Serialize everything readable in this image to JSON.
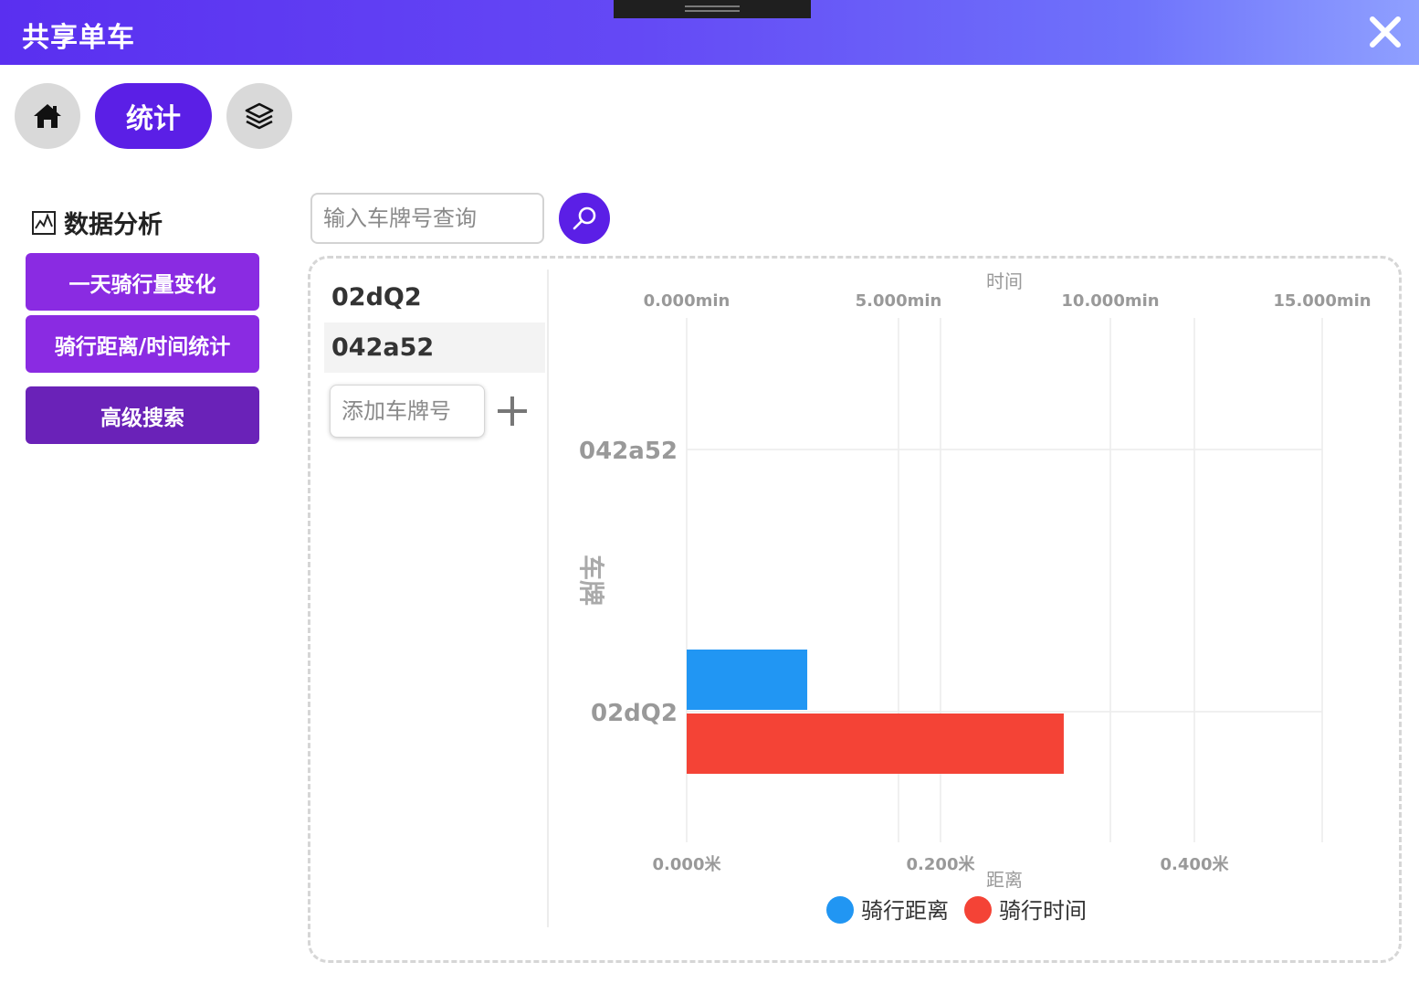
{
  "app": {
    "title": "共享单车"
  },
  "nav": {
    "home_icon": "home-icon",
    "stats_label": "统计",
    "layers_icon": "layers-icon"
  },
  "sidebar": {
    "title": "数据分析",
    "icon": "line-chart-icon",
    "items": [
      {
        "label": "一天骑行量变化"
      },
      {
        "label": "骑行距离/时间统计"
      },
      {
        "label": "高级搜索"
      }
    ]
  },
  "search": {
    "placeholder": "输入车牌号查询",
    "value": ""
  },
  "plates": {
    "items": [
      {
        "label": "02dQ2"
      },
      {
        "label": "042a52"
      }
    ],
    "add_placeholder": "添加车牌号"
  },
  "colors": {
    "accent": "#5b1fe6",
    "button": "#8a2be2",
    "distance": "#2196f3",
    "time": "#f44336"
  },
  "chart_data": {
    "type": "bar",
    "orientation": "horizontal",
    "categories": [
      "042a52",
      "02dQ2"
    ],
    "ylabel": "车牌",
    "series": [
      {
        "name": "骑行距离",
        "axis": "距离",
        "values": [
          0,
          0.095
        ],
        "color": "#2196f3"
      },
      {
        "name": "骑行时间",
        "axis": "时间",
        "values": [
          0,
          8.9
        ],
        "color": "#f44336"
      }
    ],
    "distance_axis": {
      "label": "距离",
      "ticks": [
        "0.000米",
        "0.200米",
        "0.400米"
      ],
      "range": [
        0,
        0.5
      ]
    },
    "time_axis": {
      "label": "时间",
      "ticks": [
        "0.000min",
        "5.000min",
        "10.000min",
        "15.000min"
      ],
      "range": [
        0,
        15
      ]
    },
    "grid": true,
    "legend": "bottom"
  }
}
